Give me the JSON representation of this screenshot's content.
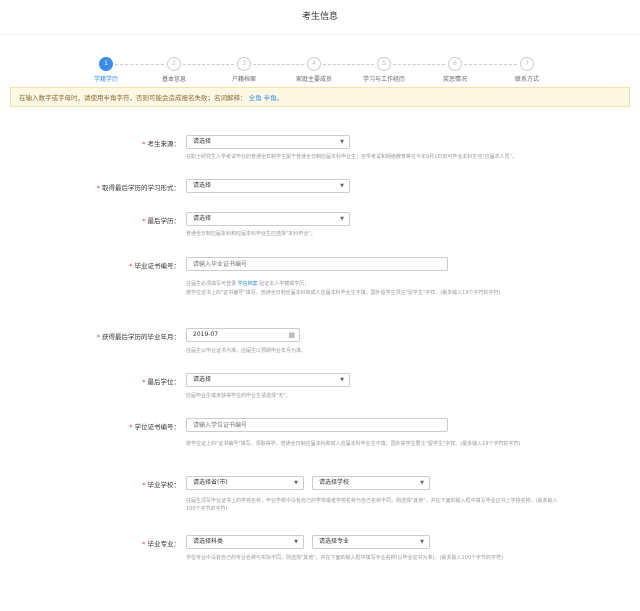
{
  "header": {
    "title": "考生信息"
  },
  "steps": [
    {
      "num": "1",
      "label": "学籍学历",
      "active": true
    },
    {
      "num": "2",
      "label": "基本信息",
      "active": false
    },
    {
      "num": "3",
      "label": "户籍档案",
      "active": false
    },
    {
      "num": "4",
      "label": "家庭主要成员",
      "active": false
    },
    {
      "num": "5",
      "label": "学习与工作经历",
      "active": false
    },
    {
      "num": "6",
      "label": "奖惩情况",
      "active": false
    },
    {
      "num": "7",
      "label": "联系方式",
      "active": false
    }
  ],
  "notice": {
    "text": "在输入数字或字母时，请使用半角字符，否则可能会造成报名失败；名词解释：",
    "link_full": "全角",
    "link_half": "半角。"
  },
  "fields": {
    "source": {
      "label": "考生来源：",
      "value": "请选择",
      "hint": "在职士研究生入学考试毕业的普通全日制学生属于普通全日制应届本科毕业生；自学考试和网络教育等在今年9月1日前可毕业本科生也\"应届本人员\"。"
    },
    "study_form": {
      "label": "取得最后学历的学习形式：",
      "value": "请选择"
    },
    "degree": {
      "label": "最后学历：",
      "value": "请选择",
      "hint": "普通全日制应届本科和应届本科毕业生应选择\"本科毕业\"。"
    },
    "cert_no": {
      "label": "毕业证书编号：",
      "placeholder": "请输入毕业证书编号",
      "hint_pre": "往届生必须填写可登录 ",
      "hint_link": "学信档案",
      "hint_post": " 验证本人学籍或学历；",
      "hint_2": "按学位证书上的\"证书编号\"填写，普通全日制应届本科和成人应届本科毕业生不填；国外留学生须注\"留学生\"字样。(最多输入19个字符的字符)"
    },
    "grad_date": {
      "label": "获得最后学历的毕业年月：",
      "value": "2019-07",
      "hint": "往届生以毕业证书为准，应届生以预期毕业年月为准。"
    },
    "last_school": {
      "label": "最后学位：",
      "value": "请选择",
      "hint": "应届毕业生或未获得学位的毕业生请选择\"无\"。"
    },
    "degree_cert": {
      "label": "学位证书编号：",
      "placeholder": "请输入学位证书编号",
      "hint": "按学位证上的\"证书编号\"填写，须取得学、普通全日制应届本科和成人应届本科毕业生不填；国外获学生要注\"留学生\"字样。(最多输入19个字符的字符)"
    },
    "school": {
      "label": "毕业学校：",
      "province": "请选择省(市)",
      "school_value": "请选择学校",
      "hint": "往届生须写毕业证书上的学校名称，毕业学校中没有自己的学校或者学校名称与自己名称不同，则选择\"其他\"，并在下面的输入框中填写毕业证书上学校名称。(最多输入100个字节的字符)"
    },
    "major": {
      "label": "毕业专业：",
      "category": "请选择科类",
      "major_value": "请选择专业",
      "hint": "学位专业中没有自己的专业名称与实际不同，则选择\"其他\"，并在下面的输入框中填写专业名称(以毕业证书为准)。(最多输入100个字节的字符)"
    }
  },
  "icons": {
    "step_connector": "dashed-line",
    "dropdown": "chevron-down-icon",
    "calendar": "calendar-icon"
  },
  "colors": {
    "accent": "#3a8ee6",
    "required": "#e33333",
    "notice_bg": "#fdf7e3"
  }
}
